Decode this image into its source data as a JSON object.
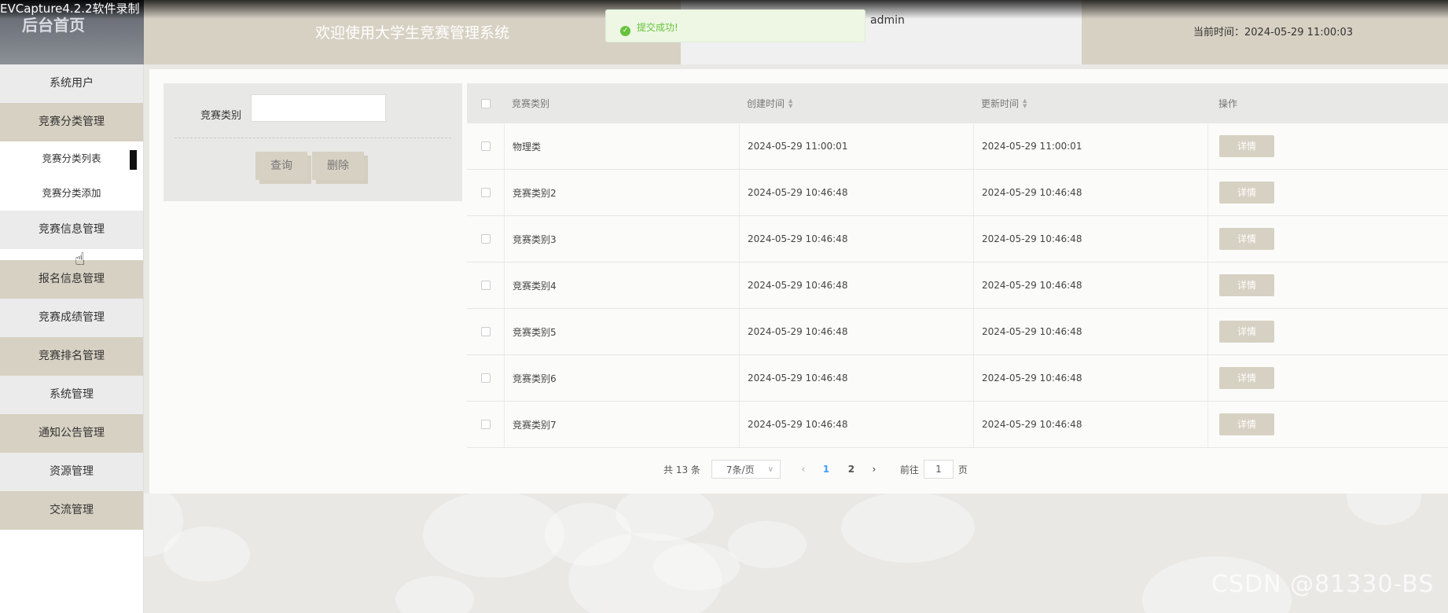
{
  "recorder_watermark": "EVCapture4.2.2软件录制",
  "header": {
    "home": "后台首页",
    "title": "欢迎使用大学生竞赛管理系统",
    "user": "admin",
    "time_label": "当前时间：2024-05-29 11:00:03"
  },
  "toast": {
    "icon": "check-circle-icon",
    "text": "提交成功!"
  },
  "sidebar": {
    "items": [
      {
        "label": "系统用户"
      },
      {
        "label": "竞赛分类管理"
      },
      {
        "label": "竞赛分类列表"
      },
      {
        "label": "竞赛分类添加"
      },
      {
        "label": "竞赛信息管理"
      },
      {
        "label": "报名信息管理"
      },
      {
        "label": "竞赛成绩管理"
      },
      {
        "label": "竞赛排名管理"
      },
      {
        "label": "系统管理"
      },
      {
        "label": "通知公告管理"
      },
      {
        "label": "资源管理"
      },
      {
        "label": "交流管理"
      }
    ]
  },
  "filter": {
    "label": "竞赛类别",
    "input_value": "",
    "query_label": "查询",
    "delete_label": "删除"
  },
  "table": {
    "columns": [
      "竞赛类别",
      "创建时间",
      "更新时间",
      "操作"
    ],
    "rows": [
      {
        "type": "物理类",
        "created": "2024-05-29 11:00:01",
        "updated": "2024-05-29 11:00:01"
      },
      {
        "type": "竞赛类别2",
        "created": "2024-05-29 10:46:48",
        "updated": "2024-05-29 10:46:48"
      },
      {
        "type": "竞赛类别3",
        "created": "2024-05-29 10:46:48",
        "updated": "2024-05-29 10:46:48"
      },
      {
        "type": "竞赛类别4",
        "created": "2024-05-29 10:46:48",
        "updated": "2024-05-29 10:46:48"
      },
      {
        "type": "竞赛类别5",
        "created": "2024-05-29 10:46:48",
        "updated": "2024-05-29 10:46:48"
      },
      {
        "type": "竞赛类别6",
        "created": "2024-05-29 10:46:48",
        "updated": "2024-05-29 10:46:48"
      },
      {
        "type": "竞赛类别7",
        "created": "2024-05-29 10:46:48",
        "updated": "2024-05-29 10:46:48"
      }
    ],
    "detail_label": "详情"
  },
  "pagination": {
    "total": "共 13 条",
    "page_size": "7条/页",
    "pages": [
      "1",
      "2"
    ],
    "current": "1",
    "goto_prefix": "前往",
    "goto_value": "1",
    "goto_suffix": "页"
  },
  "csdn_watermark": "CSDN @81330-BS",
  "colors": {
    "accent_tan": "#d7d1c3",
    "active_page": "#409eff",
    "success": "#67c23a"
  }
}
